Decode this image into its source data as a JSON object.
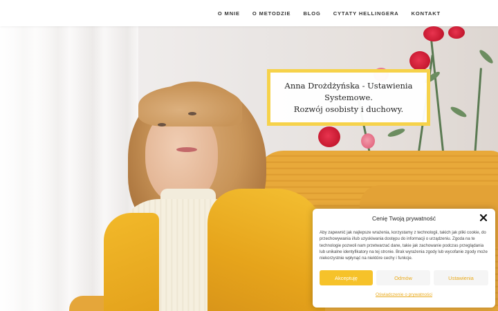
{
  "nav": {
    "items": [
      {
        "label": "O MNIE"
      },
      {
        "label": "O METODZIE"
      },
      {
        "label": "BLOG"
      },
      {
        "label": "CYTATY HELLINGERA"
      },
      {
        "label": "KONTAKT"
      }
    ]
  },
  "hero": {
    "title_line1": "Anna Drożdżyńska - Ustawienia Systemowe.",
    "title_line2": "Rozwój osobisty i duchowy.",
    "accent_color": "#f6d24a"
  },
  "cookie": {
    "title": "Cenię Twoją prywatność",
    "text": "Aby zapewnić jak najlepsze wrażenia, korzystamy z technologii, takich jak pliki cookie, do przechowywania i/lub uzyskiwania dostępu do informacji o urządzeniu. Zgoda na te technologie pozwoli nam przetwarzać dane, takie jak zachowanie podczas przeglądania lub unikalne identyfikatory na tej stronie. Brak wyrażenia zgody lub wycofanie zgody może niekorzystnie wpłynąć na niektóre cechy i funkcje.",
    "accept_label": "Akceptuję",
    "deny_label": "Odmów",
    "settings_label": "Ustawienia",
    "policy_link": "Oświadczenie o prywatności",
    "accent_color": "#f6c22a",
    "close_icon": "close-icon"
  }
}
